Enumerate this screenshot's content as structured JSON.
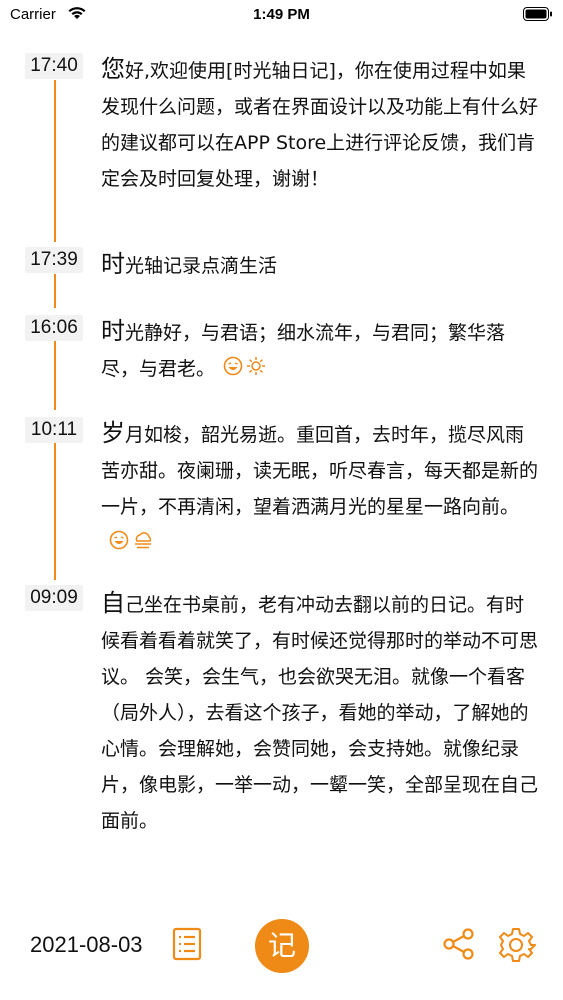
{
  "status_bar": {
    "carrier": "Carrier",
    "time": "1:49 PM"
  },
  "entries": [
    {
      "time": "17:40",
      "first_char": "您",
      "text": "好,欢迎使用[时光轴日记]，你在使用过程中如果发现什么问题，或者在界面设计以及功能上有什么好的建议都可以在APP Store上进行评论反馈，我们肯定会及时回复处理，谢谢！"
    },
    {
      "time": "17:39",
      "first_char": "时",
      "text": "光轴记录点滴生活"
    },
    {
      "time": "16:06",
      "first_char": "时",
      "text": "光静好，与君语；细水流年，与君同；繁华落尽，与君老。",
      "mood_icon": "laughing-face-icon",
      "weather_icon": "sun-icon"
    },
    {
      "time": "10:11",
      "first_char": "岁",
      "text": "月如梭，韶光易逝。重回首，去时年，揽尽风雨苦亦甜。夜阑珊，读无眠，听尽春言，每天都是新的一片，不再清闲，望着洒满月光的星星一路向前。",
      "mood_icon": "laughing-face-icon",
      "weather_icon": "fog-cloud-icon"
    },
    {
      "time": "09:09",
      "first_char": "自",
      "text": "己坐在书桌前，老有冲动去翻以前的日记。有时候看着看着就笑了，有时候还觉得那时的举动不可思议。 会笑，会生气，也会欲哭无泪。就像一个看客（局外人），去看这个孩子，看她的举动，了解她的心情。会理解她，会赞同她，会支持她。就像纪录片，像电影，一举一动，一颦一笑，全部呈现在自己面前。"
    }
  ],
  "bottom_bar": {
    "date": "2021-08-03",
    "record_label": "记"
  },
  "colors": {
    "accent": "#f08a17"
  }
}
